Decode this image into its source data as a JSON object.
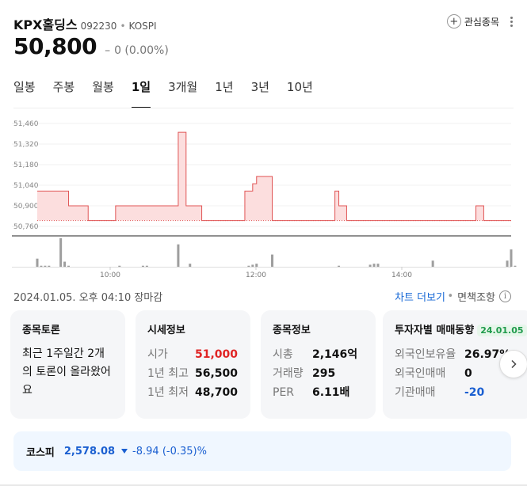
{
  "header": {
    "name": "KPX홀딩스",
    "code": "092230",
    "separator": "•",
    "market": "KOSPI",
    "watch_label": "관심종목",
    "price": "50,800",
    "change_dash": "–",
    "change": "0 (0.00%)"
  },
  "tabs": [
    "일봉",
    "주봉",
    "월봉",
    "1일",
    "3개월",
    "1년",
    "3년",
    "10년"
  ],
  "active_tab": "1일",
  "chart_data": {
    "type": "area",
    "y_ticks": [
      "51,460",
      "51,320",
      "51,180",
      "51,040",
      "50,900",
      "50,760"
    ],
    "ylim": [
      50760,
      51460
    ],
    "x_ticks": [
      "10:00",
      "12:00",
      "14:00"
    ],
    "baseline": 50800,
    "series": [
      {
        "values": [
          51000,
          51000,
          51000,
          51000,
          51000,
          51000,
          51000,
          51000,
          50900,
          50900,
          50900,
          50900,
          50900,
          50800,
          50800,
          50800,
          50800,
          50800,
          50800,
          50800,
          50900,
          50900,
          50900,
          50900,
          50900,
          50900,
          50900,
          50900,
          50900,
          50900,
          50900,
          50900,
          50900,
          50900,
          50900,
          50900,
          51400,
          51400,
          50900,
          50900,
          50900,
          50900,
          50800,
          50800,
          50800,
          50800,
          50800,
          50800,
          50800,
          50800,
          50800,
          50800,
          50800,
          51000,
          51000,
          51050,
          51100,
          51100,
          51100,
          51100,
          50800,
          50800,
          50800,
          50800,
          50800,
          50800,
          50800,
          50800,
          50800,
          50800,
          50800,
          50800,
          50800,
          50800,
          50800,
          50800,
          51000,
          50900,
          50900,
          50800,
          50800,
          50800,
          50800,
          50800,
          50800,
          50800,
          50800,
          50800,
          50800,
          50800,
          50800,
          50800,
          50800,
          50800,
          50800,
          50800,
          50800,
          50800,
          50800,
          50800,
          50800,
          50800,
          50800,
          50800,
          50800,
          50800,
          50800,
          50800,
          50800,
          50800,
          50800,
          50800,
          50900,
          50900,
          50800,
          50800,
          50800,
          50800,
          50800,
          50800,
          50800,
          50800
        ]
      }
    ],
    "volume": [
      8,
      1,
      1,
      1,
      0,
      0,
      28,
      5,
      1,
      0,
      0,
      0,
      0,
      0,
      0,
      0,
      0,
      0,
      0,
      0,
      0,
      1,
      0,
      0,
      0,
      0,
      0,
      1,
      1,
      0,
      0,
      0,
      0,
      0,
      0,
      0,
      22,
      0,
      0,
      3,
      0,
      0,
      0,
      0,
      0,
      0,
      0,
      0,
      0,
      0,
      0,
      0,
      0,
      0,
      1,
      2,
      3,
      0,
      0,
      0,
      12,
      0,
      0,
      0,
      0,
      0,
      0,
      0,
      0,
      0,
      0,
      0,
      0,
      0,
      0,
      0,
      0,
      1,
      0,
      0,
      0,
      0,
      0,
      0,
      0,
      2,
      3,
      3,
      0,
      0,
      0,
      0,
      0,
      0,
      0,
      0,
      0,
      0,
      0,
      0,
      0,
      6,
      0,
      0,
      0,
      0,
      0,
      0,
      0,
      0,
      0,
      0,
      0,
      0,
      0,
      0,
      0,
      0,
      0,
      0,
      6,
      17,
      1
    ]
  },
  "status": {
    "timestamp": "2024.01.05. 오후 04:10 장마감",
    "chart_more": "차트 더보기",
    "separator": "•",
    "disclaimer": "면책조항"
  },
  "cards": {
    "discussion": {
      "title": "종목토론",
      "text": "최근 1주일간 2개의 토론이 올라왔어요"
    },
    "market_info": {
      "title": "시세정보",
      "rows": [
        {
          "label": "시가",
          "value": "51,000"
        },
        {
          "label": "1년 최고",
          "value": "56,500"
        },
        {
          "label": "1년 최저",
          "value": "48,700"
        }
      ]
    },
    "stock_info": {
      "title": "종목정보",
      "rows": [
        {
          "label": "시총",
          "value": "2,146억"
        },
        {
          "label": "거래량",
          "value": "295"
        },
        {
          "label": "PER",
          "value": "6.11배"
        }
      ]
    },
    "investor": {
      "title": "투자자별 매매동향",
      "badge": "24.01.05",
      "rows": [
        {
          "label": "외국인보유율",
          "value": "26.97%"
        },
        {
          "label": "외국인매매",
          "value": "0"
        },
        {
          "label": "기관매매",
          "value": "-20"
        }
      ]
    }
  },
  "index": {
    "name": "코스피",
    "value": "2,578.08",
    "change": "-8.94 (-0.35)%"
  },
  "colors": {
    "up": "#e02424",
    "down": "#1a5fd1",
    "line": "#e05555",
    "fill": "#fcdede",
    "badge_bg": "#e6f6ea",
    "badge_fg": "#1f9a4b"
  }
}
